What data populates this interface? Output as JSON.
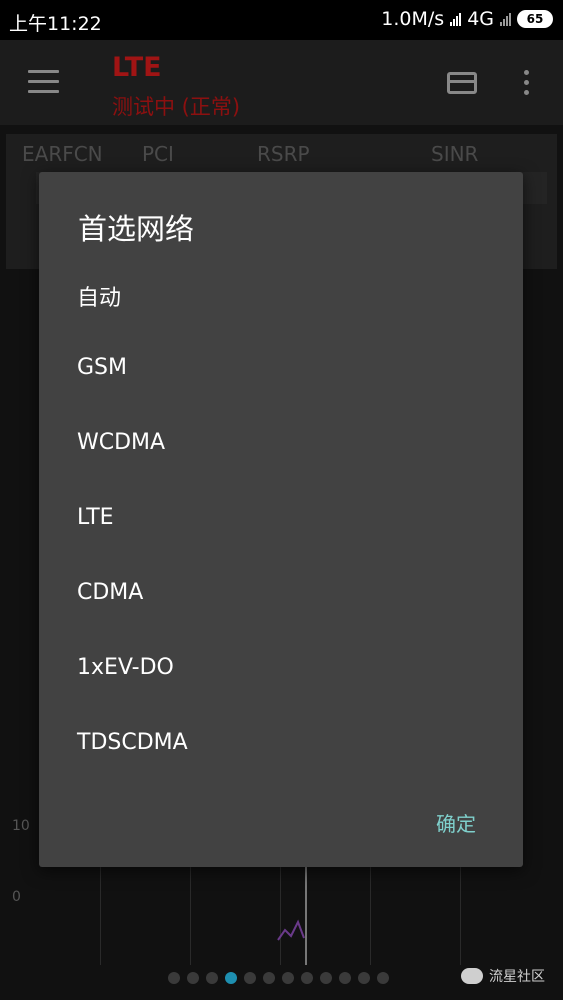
{
  "status_bar": {
    "time": "上午11:22",
    "speed": "1.0M/s",
    "network": "4G",
    "battery": "65",
    "icons": [
      "signal-icon",
      "signal-secondary-icon",
      "battery-icon"
    ]
  },
  "app": {
    "title": "LTE",
    "subtitle": "测试中 (正常)",
    "title_color": "#a01414",
    "table_headers": [
      "EARFCN",
      "PCI",
      "RSRP",
      "SINR"
    ]
  },
  "graph": {
    "y_labels": [
      "10",
      "0"
    ]
  },
  "pager": {
    "count": 12,
    "active_index": 3
  },
  "watermark": {
    "text": "流星社区"
  },
  "dialog": {
    "title": "首选网络",
    "options": [
      "自动",
      "GSM",
      "WCDMA",
      "LTE",
      "CDMA",
      "1xEV-DO",
      "TDSCDMA"
    ],
    "ok_label": "确定",
    "accent_color": "#7fd0cc",
    "background": "#424242"
  }
}
